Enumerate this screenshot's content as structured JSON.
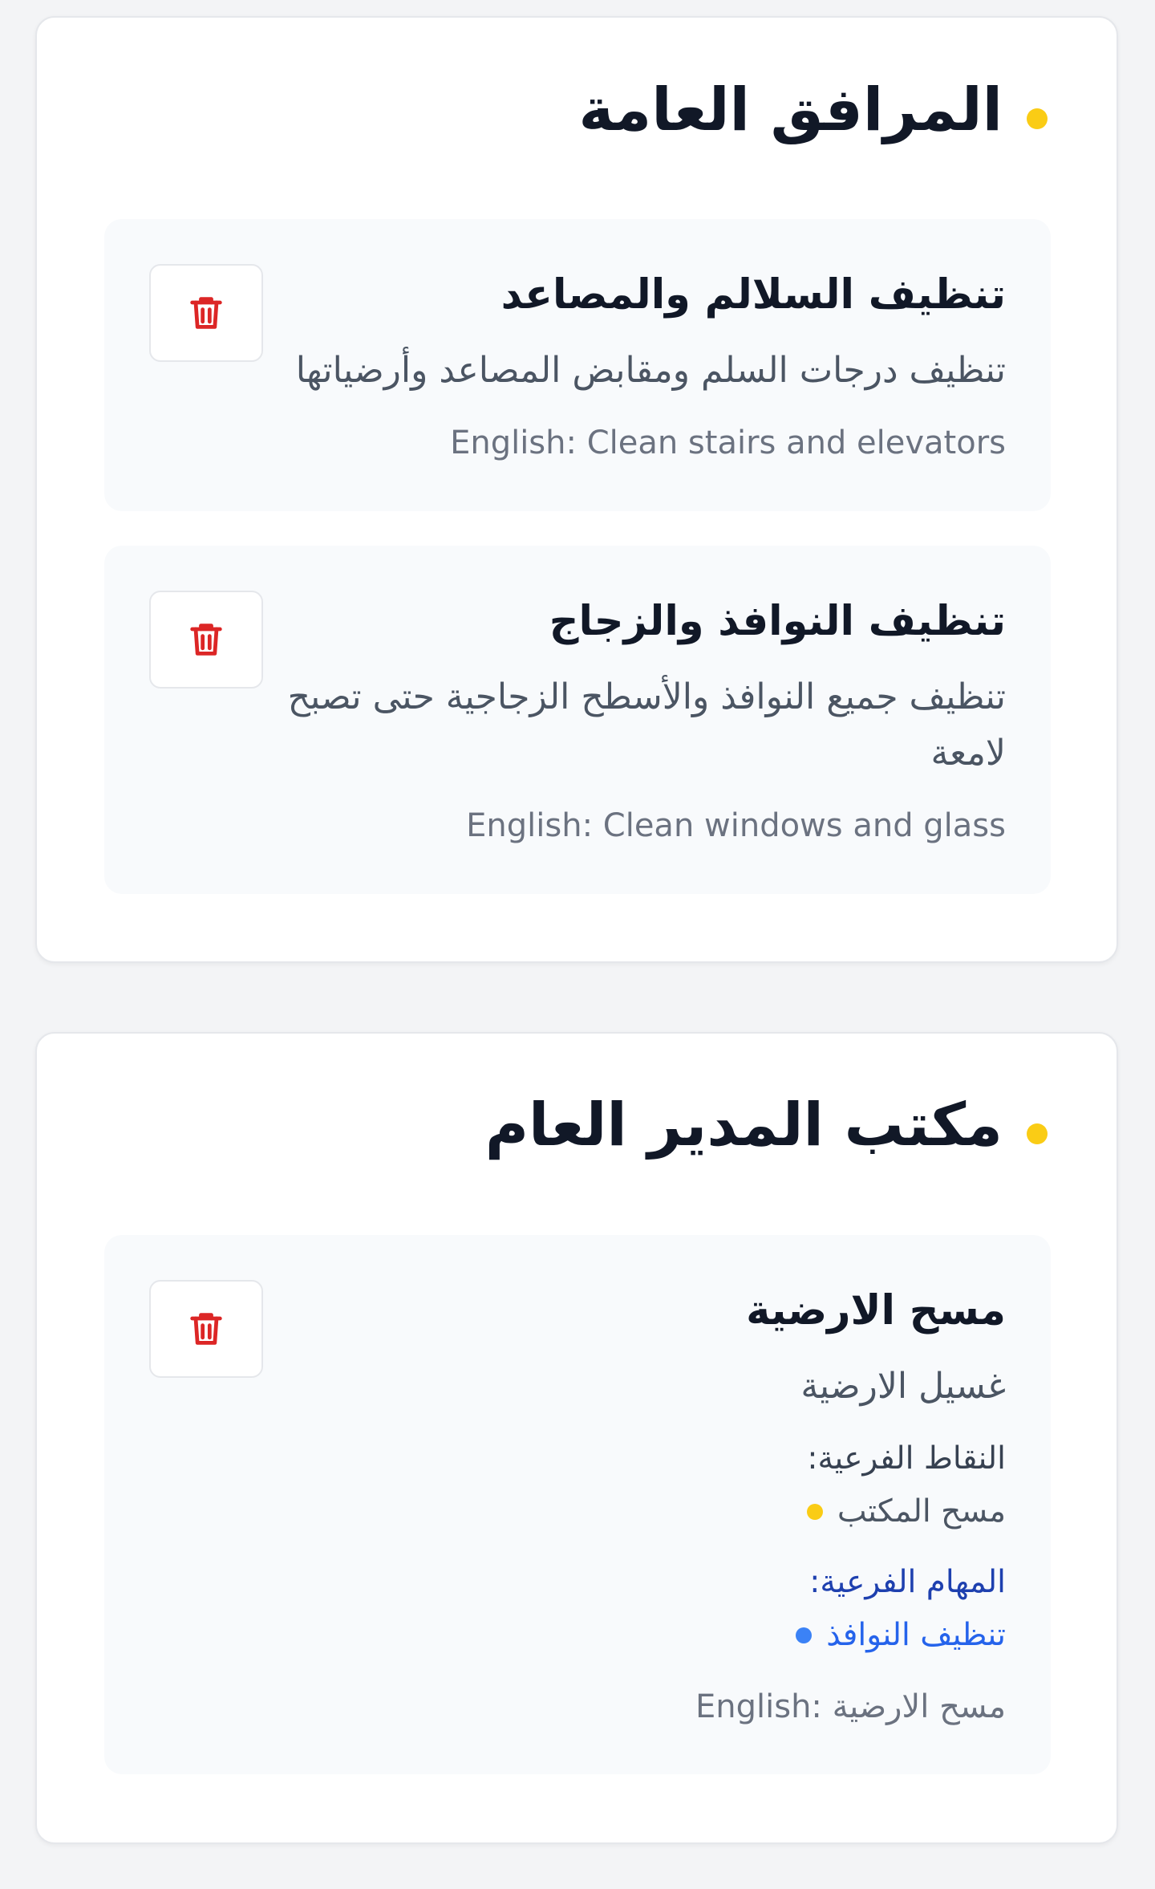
{
  "sections": [
    {
      "title": "المرافق العامة",
      "tasks": [
        {
          "title": "تنظيف السلالم والمصاعد",
          "description": "تنظيف درجات السلم ومقابض المصاعد وأرضياتها",
          "english": "English: Clean stairs and elevators"
        },
        {
          "title": "تنظيف النوافذ والزجاج",
          "description": "تنظيف جميع النوافذ والأسطح الزجاجية حتى تصبح لامعة",
          "english": "English: Clean windows and glass"
        }
      ]
    },
    {
      "title": "مكتب المدير العام",
      "tasks": [
        {
          "title": "مسح الارضية",
          "description": "غسيل الارضية",
          "subpoints_label": "النقاط الفرعية:",
          "subpoints": [
            "مسح المكتب"
          ],
          "subtasks_label": "المهام الفرعية:",
          "subtasks": [
            "تنظيف النوافذ"
          ],
          "english": "English: مسح الارضية"
        }
      ]
    }
  ],
  "icons": {
    "delete": "trash-icon"
  },
  "colors": {
    "page_bg": "#f3f4f6",
    "card_bg": "#ffffff",
    "task_bg": "#f8fafc",
    "section_dot": "#facc15",
    "subpoint_dot": "#facc15",
    "subtask_dot": "#3b82f6",
    "subtask_text": "#2563eb",
    "delete_red": "#dc2626"
  }
}
